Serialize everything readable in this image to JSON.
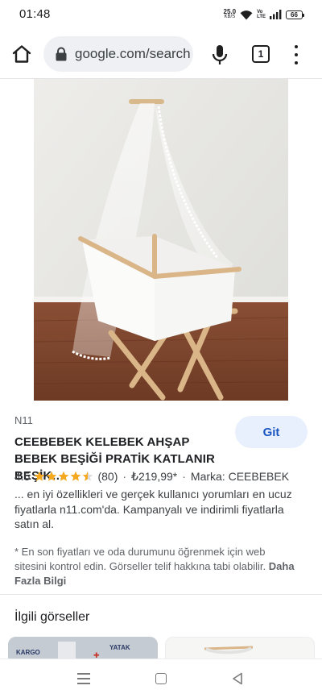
{
  "status_bar": {
    "time": "01:48",
    "net_speed_value": "25.0",
    "net_speed_unit": "KB/S",
    "volte_top": "Vo",
    "volte_bottom": "LTE",
    "battery": "66"
  },
  "browser": {
    "url": "google.com/search",
    "tab_count": "1"
  },
  "result": {
    "source": "N11",
    "go_button": "Git",
    "title": "CEEBEBEK KELEBEK AHŞAP BEBEK BEŞİĞİ PRATİK KATLANIR BEŞİK…",
    "rating": "4.5",
    "rating_fraction": 0.9,
    "review_count": "(80)",
    "price": "₺219,99*",
    "brand": "Marka: CEEBEBEK",
    "description": "... en iyi özellikleri ve gerçek kullanıcı yorumları en ucuz fiyatlarla n11.com'da. Kampanyalı ve indirimli fiyatlarla satın al.",
    "disclaimer": "* En son fiyatları ve oda durumunu öğrenmek için web sitesini kontrol edin. Görseller telif hakkına tabi olabilir.",
    "more_info": "Daha Fazla Bilgi"
  },
  "related": {
    "heading": "İlgili görseller",
    "thumb1_label_left": "KARGO",
    "thumb1_label_right": "YATAK"
  },
  "colors": {
    "accent": "#1a57c2",
    "button_bg": "#e8f0fe",
    "star": "#f4a81d",
    "url_pill": "#eef0f3"
  },
  "icons": [
    "home-icon",
    "lock-icon",
    "mic-icon",
    "tabs-icon",
    "more-vert-icon",
    "star-icon",
    "recents-icon",
    "nav-home-icon",
    "back-icon"
  ]
}
